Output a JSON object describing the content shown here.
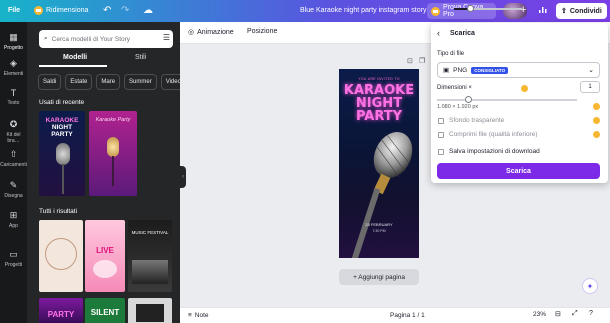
{
  "topbar": {
    "file": "File",
    "resize": "Ridimensiona",
    "title": "Blue Karaoke night party instagram story",
    "pro": "Prova Canva Pro",
    "share": "Condividi",
    "plus": "+"
  },
  "rail": [
    {
      "label": "Progetto",
      "icon": "layout-icon"
    },
    {
      "label": "Elementi",
      "icon": "shapes-icon"
    },
    {
      "label": "Testo",
      "icon": "text-icon"
    },
    {
      "label": "Kit del bra…",
      "icon": "brand-icon"
    },
    {
      "label": "Caricamenti",
      "icon": "upload-icon"
    },
    {
      "label": "Disegna",
      "icon": "draw-icon"
    },
    {
      "label": "App",
      "icon": "apps-icon"
    },
    {
      "label": "Progetti",
      "icon": "folder-icon"
    }
  ],
  "panel": {
    "search_placeholder": "Cerca modelli di Your Story",
    "tab_models": "Modelli",
    "tab_styles": "Stili",
    "chips": [
      "Saldi",
      "Estate",
      "Mare",
      "Summer",
      "Video"
    ],
    "recent_title": "Usati di recente",
    "all_title": "Tutti i risultati",
    "thumbs": {
      "karaoke": [
        "KARAOKE",
        "NIGHT",
        "PARTY"
      ],
      "karaoke_party": "Karaoke Party",
      "live": "LIVE",
      "music_festival": "MUSIC FESTIVAL",
      "party": "PARTY",
      "silent": "SILENT",
      "party2": "PARTY"
    }
  },
  "canvas_bar": {
    "animation": "Animazione",
    "position": "Posizione"
  },
  "poster": {
    "invited": "YOU ARE INVITED TO",
    "line1": "KARAOKE",
    "line2": "NIGHT",
    "line3": "PARTY",
    "date": "25 FEBRUARY",
    "time": "7:30 PM"
  },
  "add_page": "+ Aggiungi pagina",
  "bottom": {
    "notes": "Note",
    "page": "Pagina 1 / 1",
    "zoom": "23%",
    "zoom_level": 0.23
  },
  "download": {
    "title": "Scarica",
    "file_type_label": "Tipo di file",
    "file_type": "PNG",
    "badge": "CONSIGLIATO",
    "size_label": "Dimensioni ×",
    "size_value": "1",
    "size_px": "1.080 × 1.920 px",
    "transparent": "Sfondo trasparente",
    "compress": "Comprimi file (qualità inferiore)",
    "save_settings": "Salva impostazioni di download",
    "button": "Scarica"
  },
  "colors": {
    "accent": "#7d2ae8",
    "badge": "#3251e8",
    "pink_neon": "#ff73e6"
  }
}
